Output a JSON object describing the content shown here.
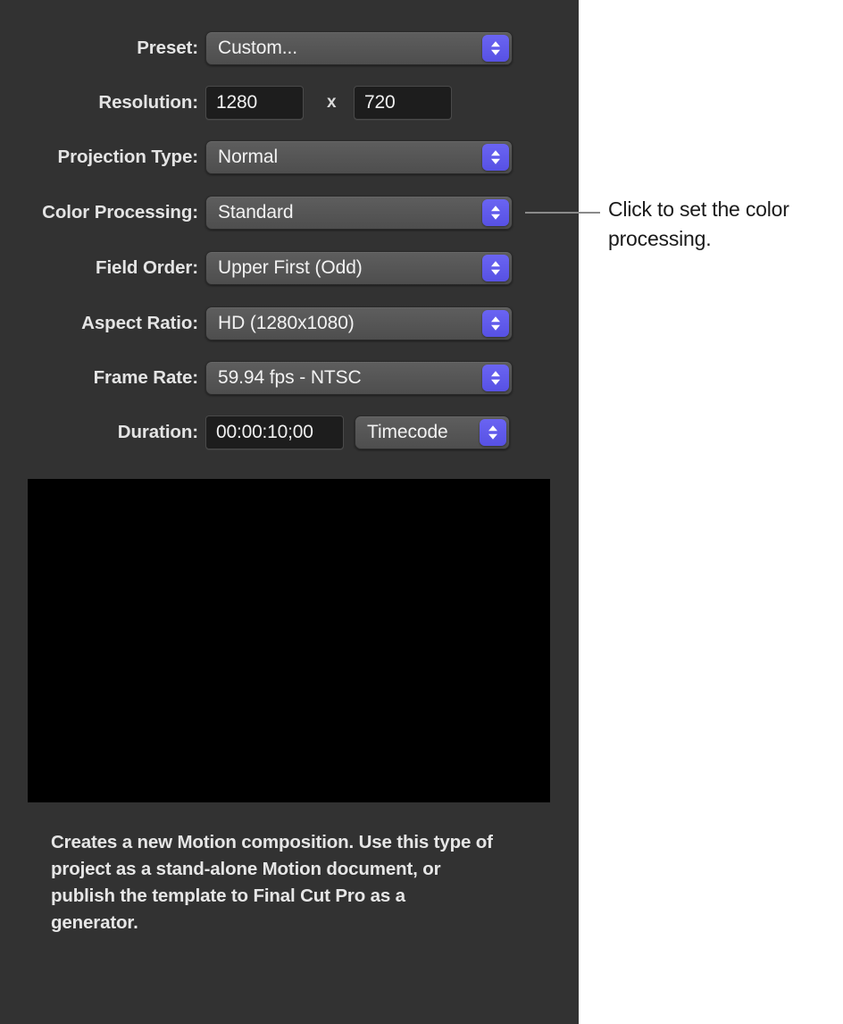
{
  "panel": {
    "rows": [
      {
        "id": "preset",
        "label": "Preset:",
        "control": "popup",
        "value": "Custom..."
      },
      {
        "id": "resolution",
        "label": "Resolution:",
        "control": "resolution",
        "width": "1280",
        "separator": "x",
        "height": "720"
      },
      {
        "id": "projection-type",
        "label": "Projection Type:",
        "control": "popup",
        "value": "Normal"
      },
      {
        "id": "color-processing",
        "label": "Color Processing:",
        "control": "popup",
        "value": "Standard"
      },
      {
        "id": "field-order",
        "label": "Field Order:",
        "control": "popup",
        "value": "Upper First (Odd)"
      },
      {
        "id": "aspect-ratio",
        "label": "Aspect Ratio:",
        "control": "popup",
        "value": "HD (1280x1080)"
      },
      {
        "id": "frame-rate",
        "label": "Frame Rate:",
        "control": "popup",
        "value": "59.94 fps - NTSC"
      },
      {
        "id": "duration",
        "label": "Duration:",
        "control": "duration",
        "value": "00:00:10;00",
        "unit": "Timecode"
      }
    ],
    "description": "Creates a new Motion composition. Use this type of project as a stand-alone Motion document, or publish the template to Final Cut Pro as a generator."
  },
  "callout": {
    "text": "Click to set the color processing."
  },
  "colors": {
    "panel_background": "#323232",
    "popup_fill": "#565656",
    "field_fill": "#1d1d1d",
    "stepper_accent": "#5b56e8",
    "label_text": "#e4e4e4",
    "value_text": "#f2f2f2",
    "preview_fill": "#000000",
    "callout_line": "#8a8a8a",
    "callout_text": "#1a1a1a",
    "page_background": "#ffffff"
  },
  "icons": {
    "stepper": "up-down-chevron-icon"
  }
}
